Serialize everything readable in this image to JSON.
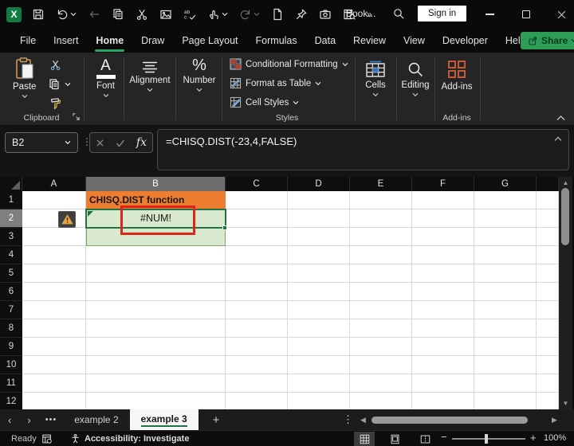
{
  "colors": {
    "excel_green": "#107C41",
    "share_green": "#2E9E57",
    "tab_underline_green": "#27A567",
    "cell_fill_orange": "#ED7D31",
    "cell_fill_green": "#D8E9CE",
    "selection_green": "#217346",
    "annotation_red": "#E0241B",
    "warning_orange": "#F2A33C"
  },
  "titlebar": {
    "qat_icons": [
      {
        "icon": "save"
      },
      {
        "icon": "undo",
        "chevron": true
      },
      {
        "icon": "back-arrow",
        "disabled": true
      },
      {
        "icon": "copy"
      },
      {
        "icon": "cut"
      },
      {
        "icon": "picture"
      },
      {
        "icon": "spelling"
      },
      {
        "icon": "touch-mode",
        "chevron": true
      },
      {
        "icon": "redo",
        "chevron": true,
        "disabled": true
      },
      {
        "icon": "new-document"
      },
      {
        "icon": "pin"
      },
      {
        "icon": "camera"
      },
      {
        "icon": "sheet-search"
      },
      {
        "icon": "more-commands"
      }
    ],
    "excel_logo_text": "X",
    "document_title": "Book...",
    "sign_in_label": "Sign in"
  },
  "menu": {
    "tabs": [
      "File",
      "Insert",
      "Home",
      "Draw",
      "Page Layout",
      "Formulas",
      "Data",
      "Review",
      "View",
      "Developer",
      "Help"
    ],
    "active_tab": "Home",
    "share_label": "Share"
  },
  "ribbon": {
    "paste_label": "Paste",
    "clipboard_group_label": "Clipboard",
    "font_group_label": "Font",
    "font_glyph": "A",
    "alignment_group_label": "Alignment",
    "number_group_label": "Number",
    "number_glyph": "%",
    "styles": {
      "items": [
        "Conditional Formatting",
        "Format as Table",
        "Cell Styles"
      ],
      "icons": [
        "conditional-formatting-icon",
        "format-as-table-icon",
        "cell-styles-icon"
      ],
      "group_label": "Styles"
    },
    "cells_label": "Cells",
    "editing_label": "Editing",
    "addins_label": "Add-ins",
    "addins_group_label": "Add-ins"
  },
  "formula_bar": {
    "name_box": "B2",
    "fx_label": "fx",
    "formula": "=CHISQ.DIST(-23,4,FALSE)"
  },
  "grid": {
    "column_headers": [
      "A",
      "B",
      "C",
      "D",
      "E",
      "F",
      "G"
    ],
    "row_count": 12,
    "selected_column": "B",
    "selected_row": "2",
    "cells": [
      {
        "ref": "B1",
        "text": "CHISQ.DIST function",
        "fill": "orange"
      },
      {
        "ref": "B2",
        "text": "#NUM!",
        "fill": "green"
      },
      {
        "ref": "B3",
        "text": "",
        "fill": "green"
      }
    ],
    "error_indicator_cell": "A2"
  },
  "sheet_tabs": {
    "tabs": [
      {
        "label": "example 2",
        "active": false
      },
      {
        "label": "example 3",
        "active": true
      }
    ]
  },
  "status_bar": {
    "mode": "Ready",
    "accessibility": "Accessibility: Investigate",
    "views": [
      "normal-view",
      "page-layout-view",
      "page-break-view"
    ],
    "zoom_level": "100%"
  }
}
